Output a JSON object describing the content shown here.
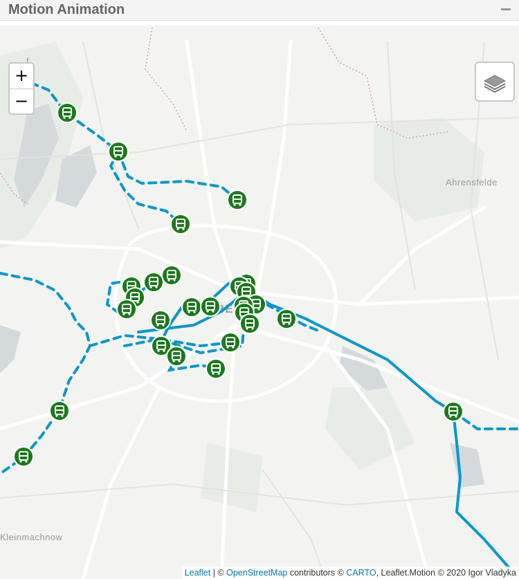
{
  "panel": {
    "title": "Motion Animation",
    "collapse_label": "−"
  },
  "map": {
    "zoom_in_label": "+",
    "zoom_out_label": "−",
    "layer_control_icon": "layers-icon",
    "marker_icon": "bus-icon",
    "place_labels": {
      "ahrensfelde": "Ahrensfelde",
      "kleinmachnow": "Kleinmachnow",
      "berlin": "BERLIN",
      "top_left": "f"
    },
    "colors": {
      "route": "#0099cc",
      "marker_fill": "#1b7a1b",
      "marker_border": "#ffffff",
      "map_background": "#f3f3f1"
    }
  },
  "attribution": {
    "leaflet": "Leaflet",
    "sep1": " | © ",
    "osm": "OpenStreetMap",
    "contributors": " contributors © ",
    "carto": "CARTO",
    "motion": ", Leaflet.Motion © 2020 Igor Vladyka"
  }
}
